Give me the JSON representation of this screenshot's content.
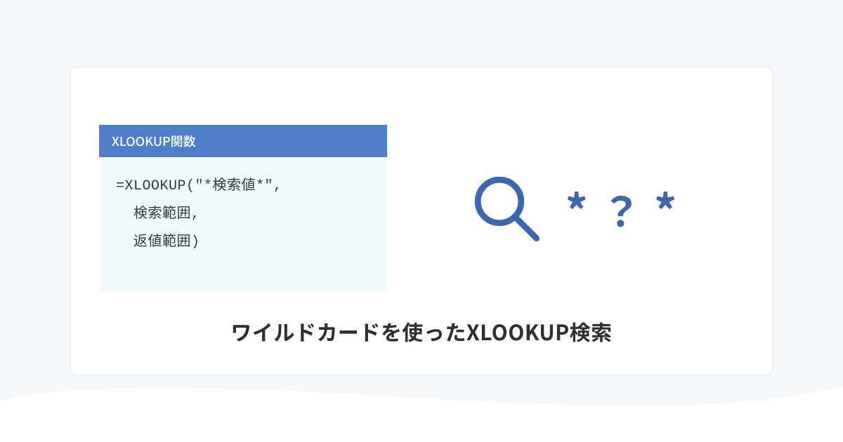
{
  "codebox": {
    "header": "XLOOKUP関数",
    "line1": "=XLOOKUP(\"*検索値*\",",
    "line2": "  検索範囲,",
    "line3": "  返値範囲)"
  },
  "wildcards": {
    "a": "*",
    "q": "？",
    "b": "*"
  },
  "caption": "ワイルドカードを使ったXLOOKUP検索"
}
